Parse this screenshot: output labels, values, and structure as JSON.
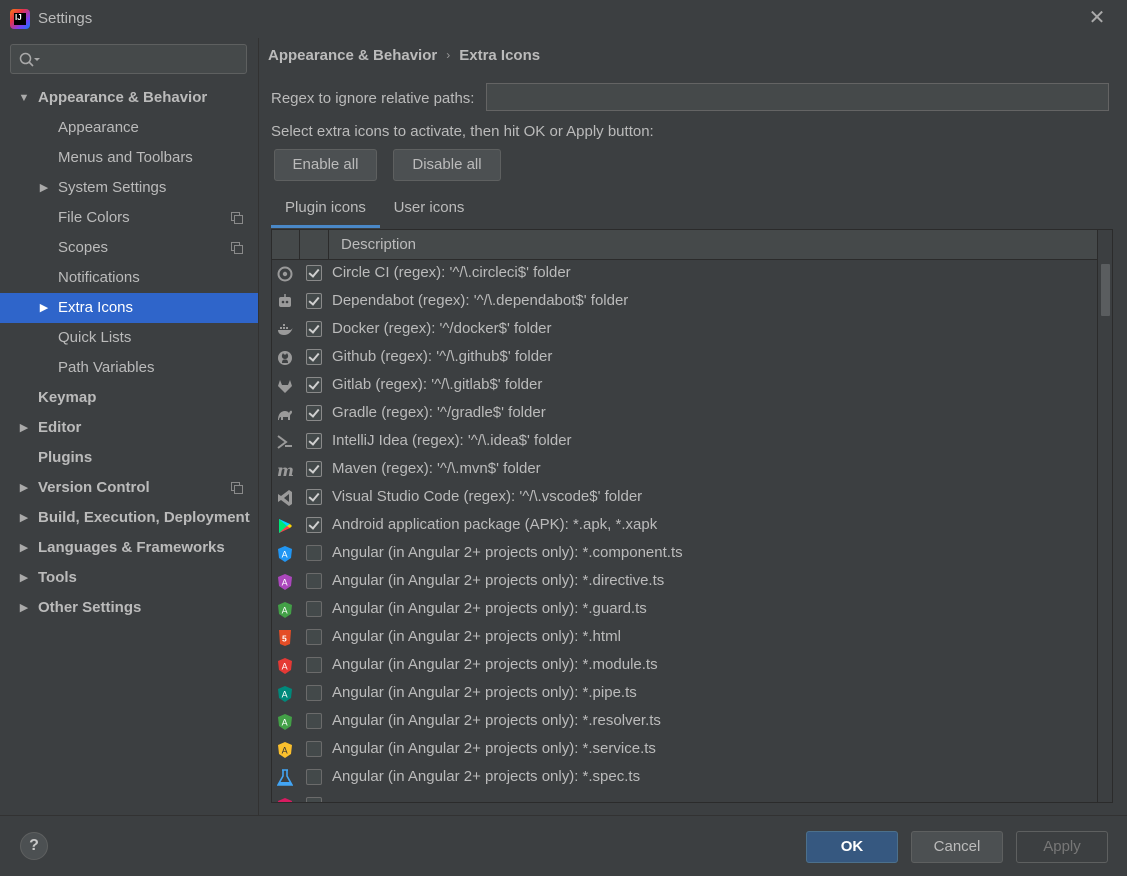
{
  "window": {
    "title": "Settings",
    "app_icon": "intellij-idea-icon",
    "close_glyph": "✕"
  },
  "search": {
    "placeholder": ""
  },
  "sidebar": {
    "items": [
      {
        "label": "Appearance & Behavior",
        "expanded": true
      },
      {
        "label": "Appearance"
      },
      {
        "label": "Menus and Toolbars"
      },
      {
        "label": "System Settings"
      },
      {
        "label": "File Colors"
      },
      {
        "label": "Scopes"
      },
      {
        "label": "Notifications"
      },
      {
        "label": "Extra Icons",
        "selected": true
      },
      {
        "label": "Quick Lists"
      },
      {
        "label": "Path Variables"
      },
      {
        "label": "Keymap"
      },
      {
        "label": "Editor"
      },
      {
        "label": "Plugins"
      },
      {
        "label": "Version Control"
      },
      {
        "label": "Build, Execution, Deployment"
      },
      {
        "label": "Languages & Frameworks"
      },
      {
        "label": "Tools"
      },
      {
        "label": "Other Settings"
      }
    ]
  },
  "breadcrumb": {
    "parent": "Appearance & Behavior",
    "separator": "›",
    "current": "Extra Icons"
  },
  "regex": {
    "label": "Regex to ignore relative paths:",
    "value": ""
  },
  "instruction": "Select extra icons to activate, then hit OK or Apply button:",
  "buttons": {
    "enable_all": "Enable all",
    "disable_all": "Disable all"
  },
  "tabs": [
    {
      "label": "Plugin icons",
      "active": true
    },
    {
      "label": "User icons"
    }
  ],
  "table": {
    "header": "Description",
    "rows": [
      {
        "icon": "circleci-icon",
        "checked": true,
        "description": "Circle CI (regex): '^/\\.circleci$' folder"
      },
      {
        "icon": "dependabot-icon",
        "checked": true,
        "description": "Dependabot (regex): '^/\\.dependabot$' folder"
      },
      {
        "icon": "docker-icon",
        "checked": true,
        "description": "Docker (regex): '^/docker$' folder"
      },
      {
        "icon": "github-icon",
        "checked": true,
        "description": "Github (regex): '^/\\.github$' folder"
      },
      {
        "icon": "gitlab-icon",
        "checked": true,
        "description": "Gitlab (regex): '^/\\.gitlab$' folder"
      },
      {
        "icon": "gradle-icon",
        "checked": true,
        "description": "Gradle (regex): '^/gradle$' folder"
      },
      {
        "icon": "intellij-icon",
        "checked": true,
        "description": "IntelliJ Idea (regex): '^/\\.idea$' folder"
      },
      {
        "icon": "maven-icon",
        "checked": true,
        "description": "Maven (regex): '^/\\.mvn$' folder"
      },
      {
        "icon": "vscode-icon",
        "checked": true,
        "description": "Visual Studio Code (regex): '^/\\.vscode$' folder"
      },
      {
        "icon": "android-apk-icon",
        "checked": true,
        "description": "Android application package (APK): *.apk, *.xapk"
      },
      {
        "icon": "angular-component-icon",
        "checked": false,
        "description": "Angular (in Angular 2+ projects only): *.component.ts"
      },
      {
        "icon": "angular-directive-icon",
        "checked": false,
        "description": "Angular (in Angular 2+ projects only): *.directive.ts"
      },
      {
        "icon": "angular-guard-icon",
        "checked": false,
        "description": "Angular (in Angular 2+ projects only): *.guard.ts"
      },
      {
        "icon": "html5-icon",
        "checked": false,
        "description": "Angular (in Angular 2+ projects only): *.html"
      },
      {
        "icon": "angular-module-icon",
        "checked": false,
        "description": "Angular (in Angular 2+ projects only): *.module.ts"
      },
      {
        "icon": "angular-pipe-icon",
        "checked": false,
        "description": "Angular (in Angular 2+ projects only): *.pipe.ts"
      },
      {
        "icon": "angular-resolver-icon",
        "checked": false,
        "description": "Angular (in Angular 2+ projects only): *.resolver.ts"
      },
      {
        "icon": "angular-service-icon",
        "checked": false,
        "description": "Angular (in Angular 2+ projects only): *.service.ts"
      },
      {
        "icon": "test-flask-icon",
        "checked": false,
        "description": "Angular (in Angular 2+ projects only): *.spec.ts"
      }
    ]
  },
  "footer": {
    "help": "?",
    "ok": "OK",
    "cancel": "Cancel",
    "apply": "Apply"
  },
  "colors": {
    "background": "#3c3f41",
    "selection": "#2f65ca",
    "ok_button": "#365880",
    "tab_underline": "#4a88c7"
  }
}
